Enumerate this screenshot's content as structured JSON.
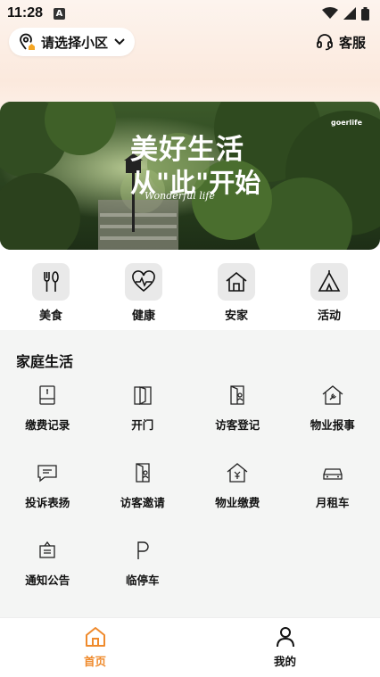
{
  "status_bar": {
    "time": "11:28",
    "notification_icon_letter": "A",
    "icons": [
      "wifi-icon",
      "signal-icon",
      "battery-icon"
    ]
  },
  "header": {
    "community_placeholder": "请选择小区",
    "service_label": "客服"
  },
  "banner": {
    "line1": "美好生活",
    "line2": "从\"此\"开始",
    "line3": "Wonderful life",
    "brand": "goerlife"
  },
  "categories": [
    {
      "label": "美食",
      "icon": "utensils-icon"
    },
    {
      "label": "健康",
      "icon": "heart-pulse-icon"
    },
    {
      "label": "安家",
      "icon": "house-icon"
    },
    {
      "label": "活动",
      "icon": "tent-icon"
    }
  ],
  "home_life": {
    "title": "家庭生活",
    "items": [
      {
        "label": "缴费记录",
        "icon": "bill-record-icon"
      },
      {
        "label": "开门",
        "icon": "door-open-icon"
      },
      {
        "label": "访客登记",
        "icon": "visitor-register-icon"
      },
      {
        "label": "物业报事",
        "icon": "property-report-icon"
      },
      {
        "label": "投诉表扬",
        "icon": "complaint-icon"
      },
      {
        "label": "访客邀请",
        "icon": "visitor-invite-icon"
      },
      {
        "label": "物业缴费",
        "icon": "property-fee-icon"
      },
      {
        "label": "月租车",
        "icon": "car-icon"
      },
      {
        "label": "通知公告",
        "icon": "notice-icon"
      },
      {
        "label": "临停车",
        "icon": "parking-icon"
      }
    ]
  },
  "tabbar": {
    "tabs": [
      {
        "label": "首页",
        "active": true
      },
      {
        "label": "我的",
        "active": false
      }
    ]
  },
  "colors": {
    "accent": "#ef8a2c",
    "section_bg": "#f4f5f4",
    "category_box": "#e9e9e9"
  }
}
